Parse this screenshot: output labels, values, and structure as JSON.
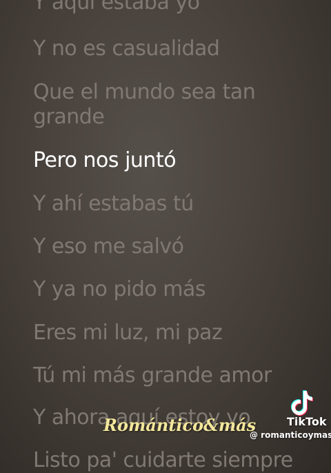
{
  "lyrics": [
    {
      "text": "Y aquí estaba yo",
      "active": false
    },
    {
      "text": "Y no es casualidad",
      "active": false
    },
    {
      "text": "Que el mundo sea tan grande",
      "active": false
    },
    {
      "text": "Pero nos juntó",
      "active": true
    },
    {
      "text": "Y ahí estabas tú",
      "active": false
    },
    {
      "text": "Y eso me salvó",
      "active": false
    },
    {
      "text": "Y ya no pido más",
      "active": false
    },
    {
      "text": "Eres mi luz, mi paz",
      "active": false
    },
    {
      "text": "Tú mi más grande amor",
      "active": false
    },
    {
      "text": "Y ahora aquí estoy yo",
      "active": false
    },
    {
      "text": "Listo pa' cuidarte siempre",
      "active": false
    }
  ],
  "watermark": "Romántico&más",
  "tiktok": {
    "icon": "tiktok-logo-icon",
    "name": "TikTok",
    "handle": "@ romanticoymas"
  },
  "colors": {
    "inactive_line": "#7f7873",
    "active_line": "#ffffff",
    "watermark": "#f3e79b",
    "tiktok_cyan": "#25f4ee",
    "tiktok_red": "#fe2c55"
  }
}
